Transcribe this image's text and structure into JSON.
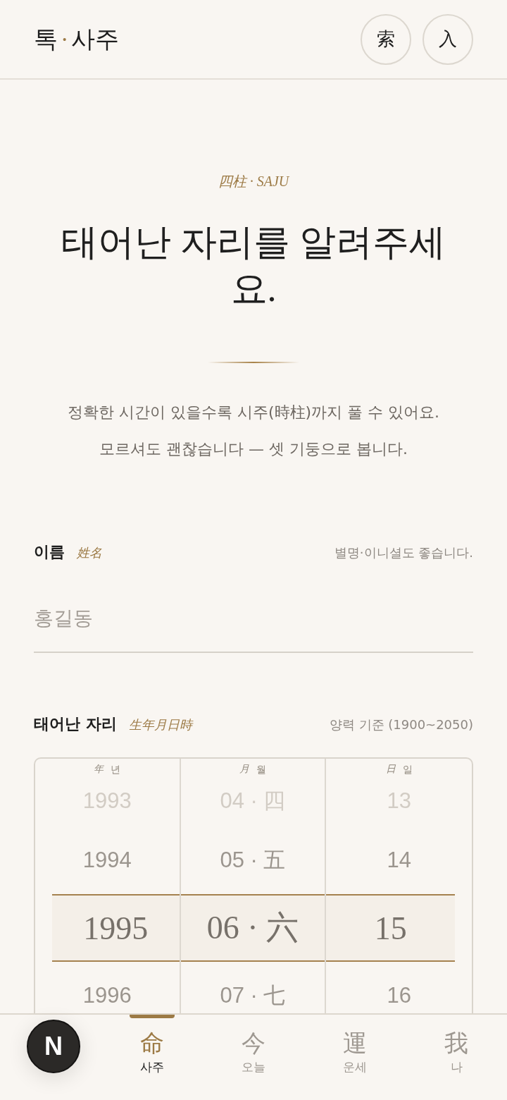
{
  "header": {
    "brand": {
      "left": "톡",
      "separator": "·",
      "right": "사주"
    },
    "buttons": [
      {
        "label": "索"
      },
      {
        "label": "入"
      }
    ]
  },
  "hero": {
    "kicker": "四柱 · SAJU",
    "title": "태어난 자리를 알려주세요.",
    "intro": [
      "정확한 시간이 있을수록 시주(時柱)까지 풀 수 있어요.",
      "모르셔도 괜찮습니다 — 셋 기둥으로 봅니다."
    ]
  },
  "name_field": {
    "label": "이름",
    "hanja": "姓名",
    "hint": "별명·이니셜도 좋습니다.",
    "placeholder": "홍길동"
  },
  "birth_field": {
    "label": "태어난 자리",
    "hanja": "生年月日時",
    "hint": "양력 기준 (1900~2050)",
    "picker": {
      "columns": [
        {
          "hanja": "年",
          "label": "년",
          "options": [
            {
              "value": "1993",
              "selected": false
            },
            {
              "value": "1994",
              "selected": false
            },
            {
              "value": "1995",
              "selected": true
            },
            {
              "value": "1996",
              "selected": false
            }
          ]
        },
        {
          "hanja": "月",
          "label": "월",
          "options": [
            {
              "value": "04 · 四",
              "selected": false
            },
            {
              "value": "05 · 五",
              "selected": false
            },
            {
              "value": "06 · 六",
              "selected": true
            },
            {
              "value": "07 · 七",
              "selected": false
            }
          ]
        },
        {
          "hanja": "日",
          "label": "일",
          "options": [
            {
              "value": "13",
              "selected": false
            },
            {
              "value": "14",
              "selected": false
            },
            {
              "value": "15",
              "selected": true
            },
            {
              "value": "16",
              "selected": false
            }
          ]
        }
      ]
    }
  },
  "tabs": [
    {
      "hanja": "命",
      "label": "사주",
      "selected": true
    },
    {
      "hanja": "今",
      "label": "오늘",
      "selected": false
    },
    {
      "hanja": "運",
      "label": "운세",
      "selected": false
    },
    {
      "hanja": "我",
      "label": "나",
      "selected": false
    }
  ],
  "dev_badge": {
    "label": "N"
  }
}
